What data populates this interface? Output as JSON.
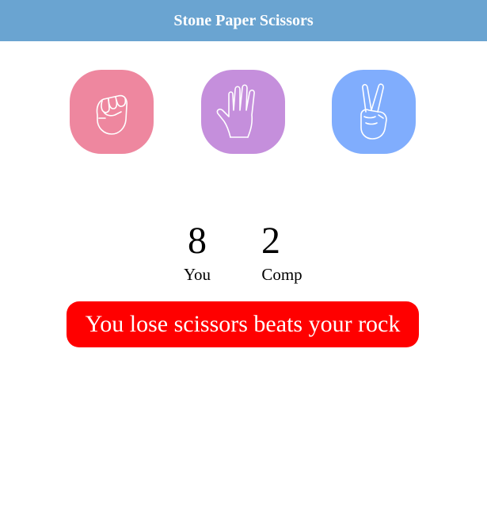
{
  "header": {
    "title": "Stone Paper Scissors",
    "color": "#6aa4d1"
  },
  "choices": [
    {
      "name": "rock",
      "icon": "fist-icon",
      "color": "#ee879f"
    },
    {
      "name": "paper",
      "icon": "open-hand-icon",
      "color": "#c58fdc"
    },
    {
      "name": "scissors",
      "icon": "peace-hand-icon",
      "color": "#80adfd"
    }
  ],
  "scoreboard": {
    "you": {
      "value": "8",
      "label": "You"
    },
    "comp": {
      "value": "2",
      "label": "Comp"
    }
  },
  "result": {
    "message": "You lose scissors beats your rock",
    "color": "#ff0000"
  }
}
